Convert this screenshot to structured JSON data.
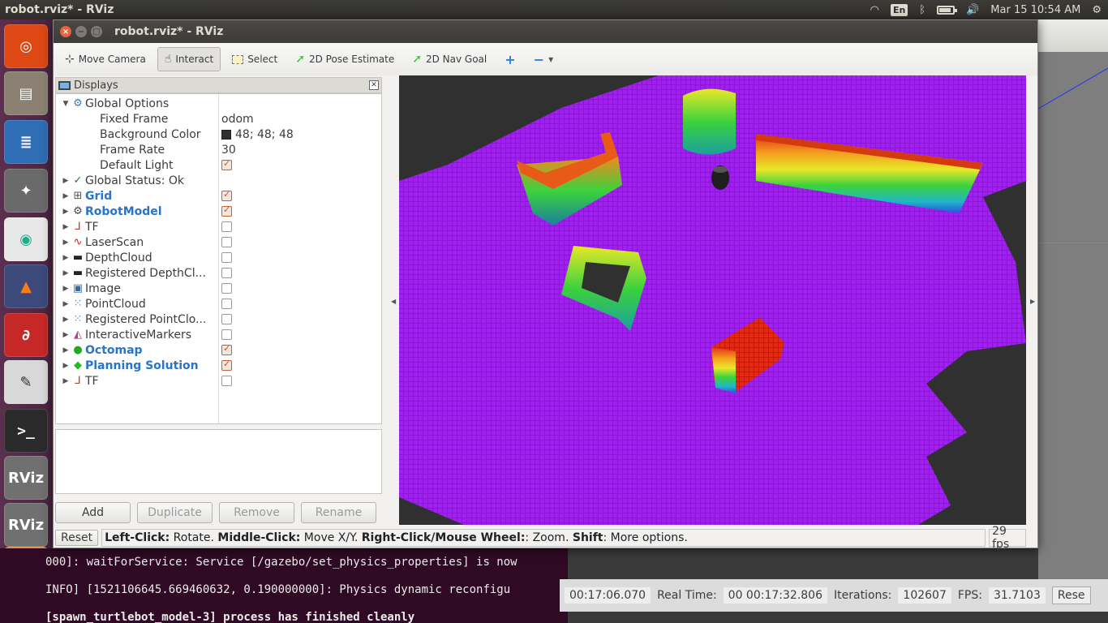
{
  "topbar": {
    "window_title": "robot.rviz* - RViz",
    "keyboard": "En",
    "datetime": "Mar 15 10:54 AM",
    "battery_level": 0.85
  },
  "launcher": {
    "items": [
      {
        "name": "ubuntu-dash",
        "label": ""
      },
      {
        "name": "files",
        "label": ""
      },
      {
        "name": "libreoffice-writer",
        "label": ""
      },
      {
        "name": "system-settings",
        "label": ""
      },
      {
        "name": "chrome",
        "label": ""
      },
      {
        "name": "matlab",
        "label": ""
      },
      {
        "name": "pdf-reader",
        "label": ""
      },
      {
        "name": "text-editor",
        "label": ""
      },
      {
        "name": "terminal",
        "label": ""
      },
      {
        "name": "rviz-1",
        "label": "RViz"
      },
      {
        "name": "rviz-2",
        "label": "RViz"
      },
      {
        "name": "gazebo",
        "label": ""
      }
    ]
  },
  "window": {
    "title": "robot.rviz* - RViz"
  },
  "toolbar": {
    "move_camera": "Move Camera",
    "interact": "Interact",
    "select": "Select",
    "pose_estimate": "2D Pose Estimate",
    "nav_goal": "2D Nav Goal",
    "add_tool": "+",
    "remove_tool": "−"
  },
  "displays": {
    "title": "Displays",
    "rows": [
      {
        "label": "Global Options",
        "value": "",
        "expand": "▼",
        "icon": "gear-icon",
        "bold": false,
        "checkbox": null,
        "indent": 0
      },
      {
        "label": "Fixed Frame",
        "value": "odom",
        "expand": "",
        "icon": "",
        "bold": false,
        "checkbox": null,
        "indent": 1
      },
      {
        "label": "Background Color",
        "value": "48; 48; 48",
        "expand": "",
        "icon": "",
        "bold": false,
        "checkbox": null,
        "indent": 1,
        "swatch": "#303030"
      },
      {
        "label": "Frame Rate",
        "value": "30",
        "expand": "",
        "icon": "",
        "bold": false,
        "checkbox": null,
        "indent": 1
      },
      {
        "label": "Default Light",
        "value": "",
        "expand": "",
        "icon": "",
        "bold": false,
        "checkbox": true,
        "indent": 1
      },
      {
        "label": "Global Status: Ok",
        "value": "",
        "expand": "▶",
        "icon": "check-icon",
        "bold": false,
        "checkbox": null,
        "indent": 0
      },
      {
        "label": "Grid",
        "value": "",
        "expand": "▶",
        "icon": "grid-icon",
        "bold": true,
        "checkbox": true,
        "indent": 0
      },
      {
        "label": "RobotModel",
        "value": "",
        "expand": "▶",
        "icon": "robot-icon",
        "bold": true,
        "checkbox": true,
        "indent": 0
      },
      {
        "label": "TF",
        "value": "",
        "expand": "▶",
        "icon": "axes-icon",
        "bold": false,
        "checkbox": false,
        "indent": 0
      },
      {
        "label": "LaserScan",
        "value": "",
        "expand": "▶",
        "icon": "laser-icon",
        "bold": false,
        "checkbox": false,
        "indent": 0
      },
      {
        "label": "DepthCloud",
        "value": "",
        "expand": "▶",
        "icon": "camera-icon",
        "bold": false,
        "checkbox": false,
        "indent": 0
      },
      {
        "label": "Registered DepthCl...",
        "value": "",
        "expand": "▶",
        "icon": "camera-icon",
        "bold": false,
        "checkbox": false,
        "indent": 0
      },
      {
        "label": "Image",
        "value": "",
        "expand": "▶",
        "icon": "image-icon",
        "bold": false,
        "checkbox": false,
        "indent": 0
      },
      {
        "label": "PointCloud",
        "value": "",
        "expand": "▶",
        "icon": "pointcloud-icon",
        "bold": false,
        "checkbox": false,
        "indent": 0
      },
      {
        "label": "Registered PointClo...",
        "value": "",
        "expand": "▶",
        "icon": "pointcloud-icon",
        "bold": false,
        "checkbox": false,
        "indent": 0
      },
      {
        "label": "InteractiveMarkers",
        "value": "",
        "expand": "▶",
        "icon": "markers-icon",
        "bold": false,
        "checkbox": false,
        "indent": 0
      },
      {
        "label": "Octomap",
        "value": "",
        "expand": "▶",
        "icon": "octomap-icon",
        "bold": true,
        "checkbox": true,
        "indent": 0
      },
      {
        "label": "Planning Solution",
        "value": "",
        "expand": "▶",
        "icon": "cube-icon",
        "bold": true,
        "checkbox": true,
        "indent": 0
      },
      {
        "label": "TF",
        "value": "",
        "expand": "▶",
        "icon": "axes-icon",
        "bold": false,
        "checkbox": false,
        "indent": 0
      }
    ],
    "buttons": {
      "add": "Add",
      "duplicate": "Duplicate",
      "remove": "Remove",
      "rename": "Rename"
    }
  },
  "statusbar": {
    "reset": "Reset",
    "help_parts": [
      {
        "text": "Left-Click:",
        "bold": true
      },
      {
        "text": " Rotate. ",
        "bold": false
      },
      {
        "text": "Middle-Click:",
        "bold": true
      },
      {
        "text": " Move X/Y. ",
        "bold": false
      },
      {
        "text": "Right-Click/Mouse Wheel:",
        "bold": true
      },
      {
        "text": ": Zoom. ",
        "bold": false
      },
      {
        "text": "Shift",
        "bold": true
      },
      {
        "text": ": More options.",
        "bold": false
      }
    ],
    "fps": "29 fps"
  },
  "terminal": {
    "lines": [
      "000]: waitForService: Service [/gazebo/set_physics_properties] is now",
      " INFO] [1521106645.669460632, 0.190000000]: Physics dynamic reconfigu",
      "[spawn_turtlebot_model-3] process has finished cleanly"
    ]
  },
  "gazebo": {
    "sim_time": "00:17:06.070",
    "real_time_label": "Real Time:",
    "real_time": "00 00:17:32.806",
    "iterations_label": "Iterations:",
    "iterations": "102607",
    "fps_label": "FPS:",
    "fps": "31.7103",
    "reset": "Rese"
  }
}
